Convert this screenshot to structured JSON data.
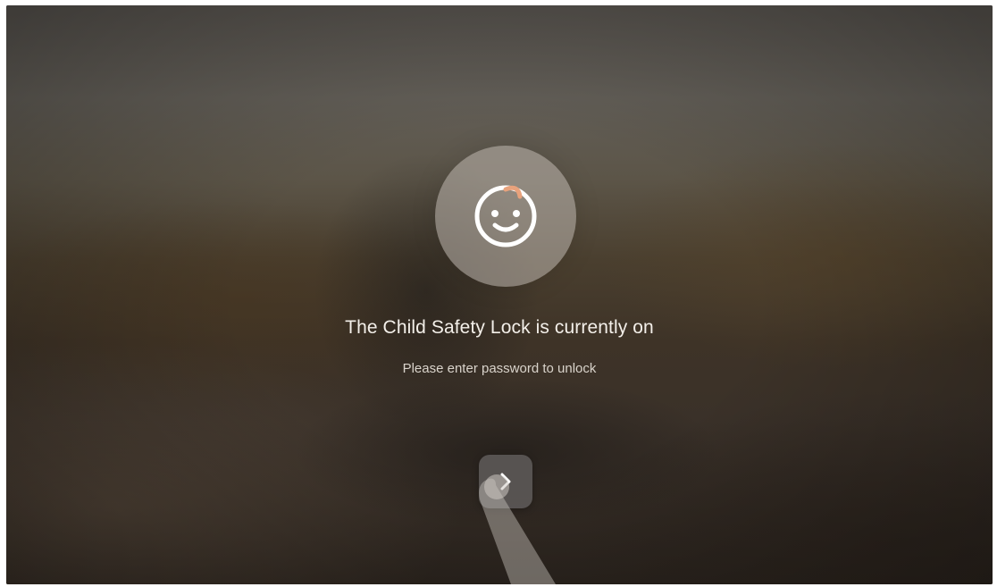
{
  "lock_screen": {
    "icon": "baby-face-icon",
    "title": "The Child Safety Lock is currently on",
    "subtitle": "Please enter password to unlock",
    "next_button_icon": "chevron-right-icon"
  },
  "colors": {
    "text_primary": "#f3efe9",
    "text_secondary": "#d9d3cb",
    "icon_stroke": "#ffffff",
    "icon_accent": "#e8a27c"
  }
}
